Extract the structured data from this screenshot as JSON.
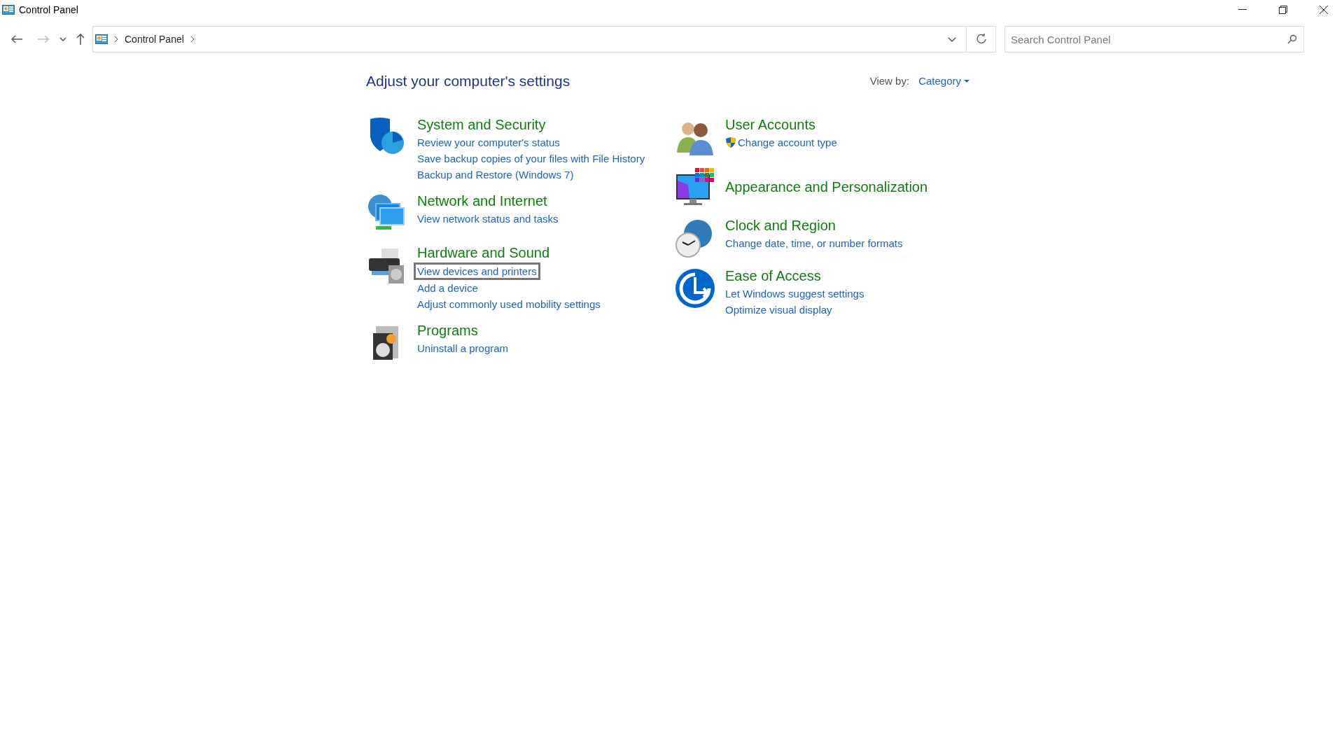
{
  "window": {
    "title": "Control Panel"
  },
  "address_bar": {
    "crumbs": [
      "Control Panel"
    ]
  },
  "search": {
    "placeholder": "Search Control Panel"
  },
  "heading": "Adjust your computer's settings",
  "view_by": {
    "label": "View by:",
    "value": "Category"
  },
  "columns": [
    [
      {
        "title": "System and Security",
        "links": [
          {
            "text": "Review your computer's status",
            "admin": false,
            "focused": false
          },
          {
            "text": "Save backup copies of your files with File History",
            "admin": false,
            "focused": false
          },
          {
            "text": "Backup and Restore (Windows 7)",
            "admin": false,
            "focused": false
          }
        ]
      },
      {
        "title": "Network and Internet",
        "links": [
          {
            "text": "View network status and tasks",
            "admin": false,
            "focused": false
          }
        ]
      },
      {
        "title": "Hardware and Sound",
        "links": [
          {
            "text": "View devices and printers",
            "admin": false,
            "focused": true
          },
          {
            "text": "Add a device",
            "admin": false,
            "focused": false
          },
          {
            "text": "Adjust commonly used mobility settings",
            "admin": false,
            "focused": false
          }
        ]
      },
      {
        "title": "Programs",
        "links": [
          {
            "text": "Uninstall a program",
            "admin": false,
            "focused": false
          }
        ]
      }
    ],
    [
      {
        "title": "User Accounts",
        "links": [
          {
            "text": "Change account type",
            "admin": true,
            "focused": false
          }
        ]
      },
      {
        "title": "Appearance and Personalization"
      },
      {
        "title": "Clock and Region",
        "links": [
          {
            "text": "Change date, time, or number formats",
            "admin": false,
            "focused": false
          }
        ]
      },
      {
        "title": "Ease of Access",
        "links": [
          {
            "text": "Let Windows suggest settings",
            "admin": false,
            "focused": false
          },
          {
            "text": "Optimize visual display",
            "admin": false,
            "focused": false
          }
        ]
      }
    ]
  ]
}
